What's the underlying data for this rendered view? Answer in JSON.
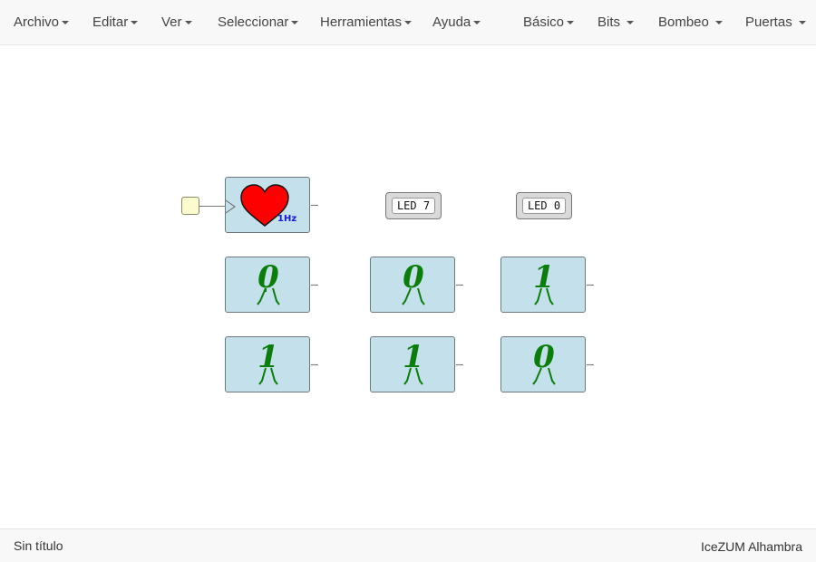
{
  "menu": {
    "left": [
      "Archivo",
      "Editar",
      "Ver",
      "Seleccionar",
      "Herramientas",
      "Ayuda"
    ],
    "right": [
      "Básico",
      "Bits",
      "Bombeo",
      "Puertas"
    ]
  },
  "circuit": {
    "clock": {
      "frequency_label": "1Hz",
      "icon": "heart-icon",
      "color": "#ff0000"
    },
    "leds": [
      {
        "label": "LED 7"
      },
      {
        "label": "LED 0"
      }
    ],
    "constants": {
      "row1": [
        "0",
        "0",
        "1"
      ],
      "row2": [
        "1",
        "1",
        "0"
      ]
    },
    "bit_color": "#0a7d0a"
  },
  "status": {
    "file_name": "Sin título",
    "board": "IceZUM Alhambra"
  }
}
